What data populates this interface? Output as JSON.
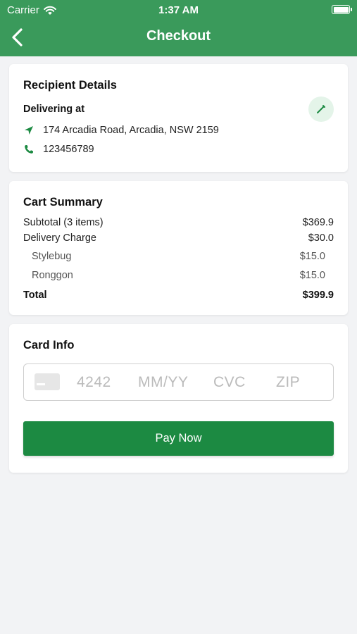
{
  "status_bar": {
    "carrier": "Carrier",
    "time": "1:37 AM"
  },
  "header": {
    "title": "Checkout",
    "accent_color": "#3a9a5b"
  },
  "recipient": {
    "title": "Recipient Details",
    "delivering_label": "Delivering at",
    "address": "174 Arcadia Road, Arcadia, NSW 2159",
    "phone": "123456789",
    "address_icon": "navigation-arrow-icon",
    "phone_icon": "phone-icon",
    "edit_icon": "pencil-icon"
  },
  "cart": {
    "title": "Cart Summary",
    "subtotal_label": "Subtotal (3 items)",
    "subtotal_value": "$369.9",
    "delivery_label": "Delivery Charge",
    "delivery_value": "$30.0",
    "vendors": [
      {
        "name": "Stylebug",
        "value": "$15.0"
      },
      {
        "name": "Ronggon",
        "value": "$15.0"
      }
    ],
    "total_label": "Total",
    "total_value": "$399.9"
  },
  "card_info": {
    "title": "Card Info",
    "number_placeholder": "4242",
    "expiry_placeholder": "MM/YY",
    "cvc_placeholder": "CVC",
    "zip_placeholder": "ZIP"
  },
  "pay_button": {
    "label": "Pay Now",
    "color": "#1c8a42"
  }
}
